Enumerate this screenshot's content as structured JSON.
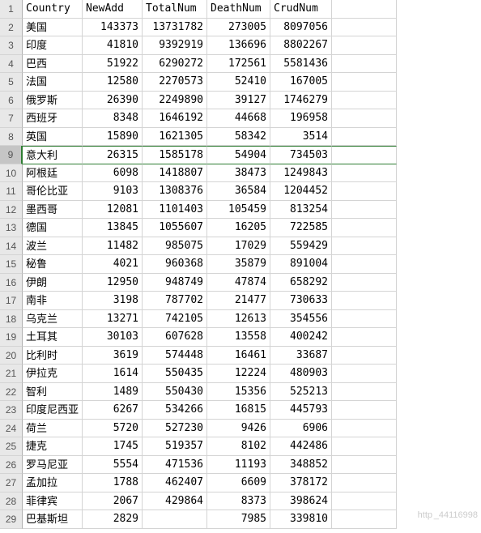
{
  "chart_data": {
    "type": "table",
    "columns": [
      "Country",
      "NewAdd",
      "TotalNum",
      "DeathNum",
      "CrudNum"
    ],
    "rows": [
      {
        "row": 2,
        "Country": "美国",
        "NewAdd": 143373,
        "TotalNum": 13731782,
        "DeathNum": 273005,
        "CrudNum": 8097056
      },
      {
        "row": 3,
        "Country": "印度",
        "NewAdd": 41810,
        "TotalNum": 9392919,
        "DeathNum": 136696,
        "CrudNum": 8802267
      },
      {
        "row": 4,
        "Country": "巴西",
        "NewAdd": 51922,
        "TotalNum": 6290272,
        "DeathNum": 172561,
        "CrudNum": 5581436
      },
      {
        "row": 5,
        "Country": "法国",
        "NewAdd": 12580,
        "TotalNum": 2270573,
        "DeathNum": 52410,
        "CrudNum": 167005
      },
      {
        "row": 6,
        "Country": "俄罗斯",
        "NewAdd": 26390,
        "TotalNum": 2249890,
        "DeathNum": 39127,
        "CrudNum": 1746279
      },
      {
        "row": 7,
        "Country": "西班牙",
        "NewAdd": 8348,
        "TotalNum": 1646192,
        "DeathNum": 44668,
        "CrudNum": 196958
      },
      {
        "row": 8,
        "Country": "英国",
        "NewAdd": 15890,
        "TotalNum": 1621305,
        "DeathNum": 58342,
        "CrudNum": 3514
      },
      {
        "row": 9,
        "Country": "意大利",
        "NewAdd": 26315,
        "TotalNum": 1585178,
        "DeathNum": 54904,
        "CrudNum": 734503
      },
      {
        "row": 10,
        "Country": "阿根廷",
        "NewAdd": 6098,
        "TotalNum": 1418807,
        "DeathNum": 38473,
        "CrudNum": 1249843
      },
      {
        "row": 11,
        "Country": "哥伦比亚",
        "NewAdd": 9103,
        "TotalNum": 1308376,
        "DeathNum": 36584,
        "CrudNum": 1204452
      },
      {
        "row": 12,
        "Country": "墨西哥",
        "NewAdd": 12081,
        "TotalNum": 1101403,
        "DeathNum": 105459,
        "CrudNum": 813254
      },
      {
        "row": 13,
        "Country": "德国",
        "NewAdd": 13845,
        "TotalNum": 1055607,
        "DeathNum": 16205,
        "CrudNum": 722585
      },
      {
        "row": 14,
        "Country": "波兰",
        "NewAdd": 11482,
        "TotalNum": 985075,
        "DeathNum": 17029,
        "CrudNum": 559429
      },
      {
        "row": 15,
        "Country": "秘鲁",
        "NewAdd": 4021,
        "TotalNum": 960368,
        "DeathNum": 35879,
        "CrudNum": 891004
      },
      {
        "row": 16,
        "Country": "伊朗",
        "NewAdd": 12950,
        "TotalNum": 948749,
        "DeathNum": 47874,
        "CrudNum": 658292
      },
      {
        "row": 17,
        "Country": "南非",
        "NewAdd": 3198,
        "TotalNum": 787702,
        "DeathNum": 21477,
        "CrudNum": 730633
      },
      {
        "row": 18,
        "Country": "乌克兰",
        "NewAdd": 13271,
        "TotalNum": 742105,
        "DeathNum": 12613,
        "CrudNum": 354556
      },
      {
        "row": 19,
        "Country": "土耳其",
        "NewAdd": 30103,
        "TotalNum": 607628,
        "DeathNum": 13558,
        "CrudNum": 400242
      },
      {
        "row": 20,
        "Country": "比利时",
        "NewAdd": 3619,
        "TotalNum": 574448,
        "DeathNum": 16461,
        "CrudNum": 33687
      },
      {
        "row": 21,
        "Country": "伊拉克",
        "NewAdd": 1614,
        "TotalNum": 550435,
        "DeathNum": 12224,
        "CrudNum": 480903
      },
      {
        "row": 22,
        "Country": "智利",
        "NewAdd": 1489,
        "TotalNum": 550430,
        "DeathNum": 15356,
        "CrudNum": 525213
      },
      {
        "row": 23,
        "Country": "印度尼西亚",
        "NewAdd": 6267,
        "TotalNum": 534266,
        "DeathNum": 16815,
        "CrudNum": 445793
      },
      {
        "row": 24,
        "Country": "荷兰",
        "NewAdd": 5720,
        "TotalNum": 527230,
        "DeathNum": 9426,
        "CrudNum": 6906
      },
      {
        "row": 25,
        "Country": "捷克",
        "NewAdd": 1745,
        "TotalNum": 519357,
        "DeathNum": 8102,
        "CrudNum": 442486
      },
      {
        "row": 26,
        "Country": "罗马尼亚",
        "NewAdd": 5554,
        "TotalNum": 471536,
        "DeathNum": 11193,
        "CrudNum": 348852
      },
      {
        "row": 27,
        "Country": "孟加拉",
        "NewAdd": 1788,
        "TotalNum": 462407,
        "DeathNum": 6609,
        "CrudNum": 378172
      },
      {
        "row": 28,
        "Country": "菲律宾",
        "NewAdd": 2067,
        "TotalNum": 429864,
        "DeathNum": 8373,
        "CrudNum": 398624
      },
      {
        "row": 29,
        "Country": "巴基斯坦",
        "NewAdd": 2829,
        "TotalNum": "",
        "DeathNum": 7985,
        "CrudNum": 339810
      }
    ]
  },
  "selected_row": 9,
  "watermark1": "http",
  "watermark2": "_44116998"
}
